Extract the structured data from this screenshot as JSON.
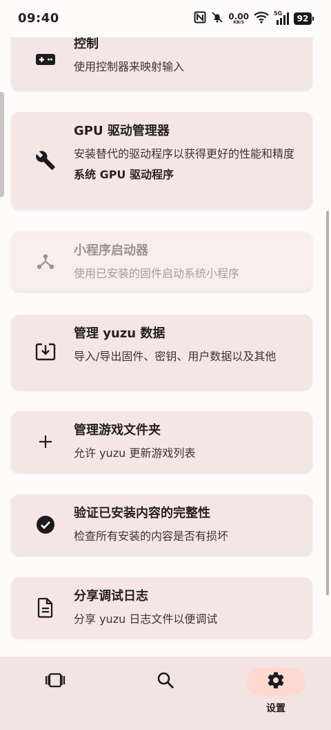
{
  "status_bar": {
    "time": "09:40",
    "net_speed_value": "0.00",
    "net_speed_unit": "KB/S",
    "network_label": "5G",
    "battery": "92",
    "icons": [
      "nfc-icon",
      "bell-off-icon",
      "wifi-icon",
      "signal-icon",
      "battery-icon"
    ]
  },
  "settings_list": [
    {
      "id": "controls",
      "icon": "gamepad-icon",
      "title": "控制",
      "description": "使用控制器来映射输入",
      "enabled": true
    },
    {
      "id": "gpu-driver-manager",
      "icon": "wrench-icon",
      "title": "GPU 驱动管理器",
      "description": "安装替代的驱动程序以获得更好的性能和精度",
      "extra": "系统 GPU 驱动程序",
      "enabled": true
    },
    {
      "id": "applet-launcher",
      "icon": "applet-icon",
      "title": "小程序启动器",
      "description": "使用已安装的固件启动系统小程序",
      "enabled": false
    },
    {
      "id": "manage-yuzu-data",
      "icon": "download-box-icon",
      "title": "管理 yuzu 数据",
      "description": "导入/导出固件、密钥、用户数据以及其他",
      "enabled": true
    },
    {
      "id": "manage-game-folders",
      "icon": "plus-icon",
      "title": "管理游戏文件夹",
      "description": "允许 yuzu 更新游戏列表",
      "enabled": true
    },
    {
      "id": "verify-installed-content",
      "icon": "check-circle-icon",
      "title": "验证已安装内容的完整性",
      "description": "检查所有安装的内容是否有损坏",
      "enabled": true
    },
    {
      "id": "share-debug-log",
      "icon": "document-icon",
      "title": "分享调试日志",
      "description": "分享 yuzu 日志文件以便调试",
      "enabled": true
    }
  ],
  "bottom_nav": {
    "items": [
      {
        "id": "games",
        "icon": "game-carousel-icon",
        "label": "",
        "active": false
      },
      {
        "id": "search",
        "icon": "search-icon",
        "label": "",
        "active": false
      },
      {
        "id": "settings",
        "icon": "gear-icon",
        "label": "设置",
        "active": true
      }
    ]
  },
  "colors": {
    "background": "#fefbfb",
    "card": "#f5e6e6",
    "nav_background": "#f3e4e4",
    "nav_active_pill": "#ffd9d0"
  }
}
